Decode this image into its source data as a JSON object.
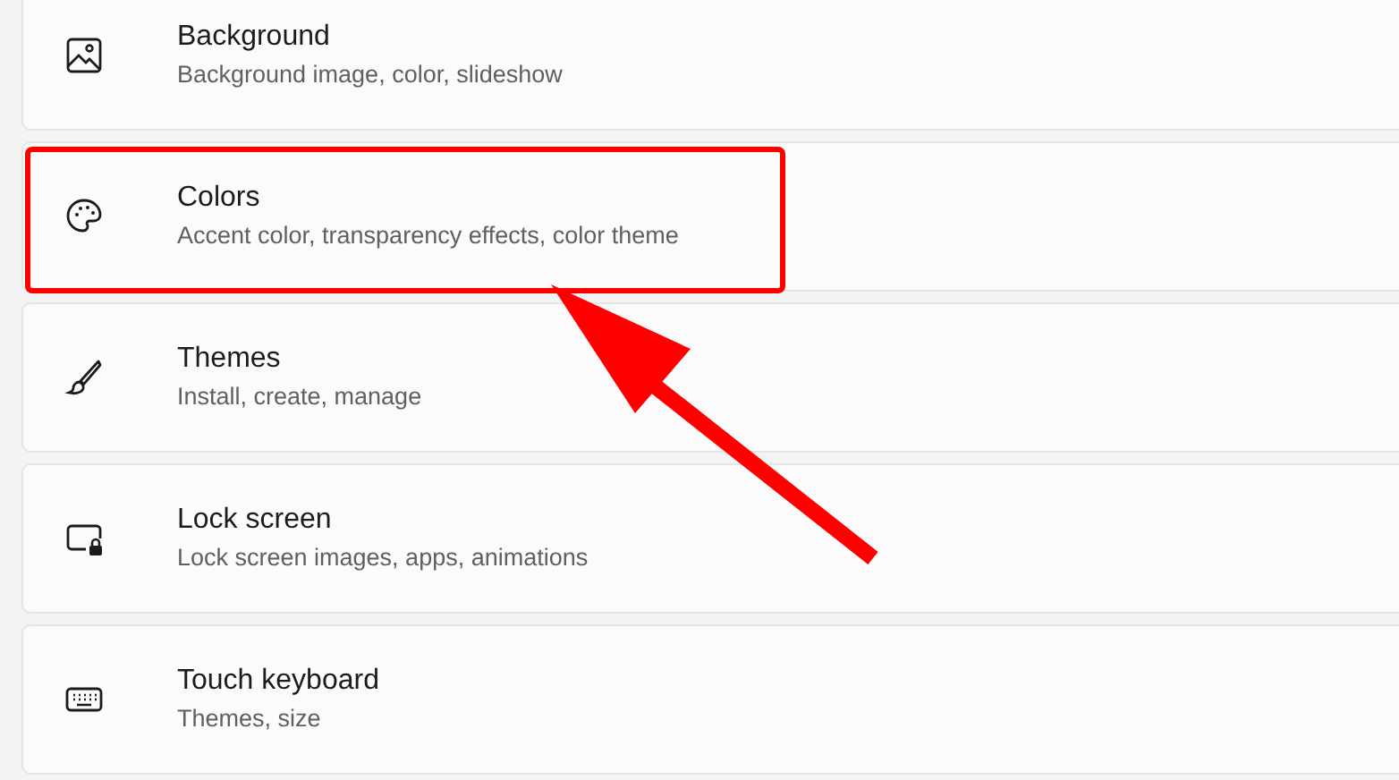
{
  "settings_items": [
    {
      "title": "Background",
      "subtitle": "Background image, color, slideshow",
      "highlighted": false
    },
    {
      "title": "Colors",
      "subtitle": "Accent color, transparency effects, color theme",
      "highlighted": true
    },
    {
      "title": "Themes",
      "subtitle": "Install, create, manage",
      "highlighted": false
    },
    {
      "title": "Lock screen",
      "subtitle": "Lock screen images, apps, animations",
      "highlighted": false
    },
    {
      "title": "Touch keyboard",
      "subtitle": "Themes, size",
      "highlighted": false
    }
  ],
  "annotation_arrow": true
}
